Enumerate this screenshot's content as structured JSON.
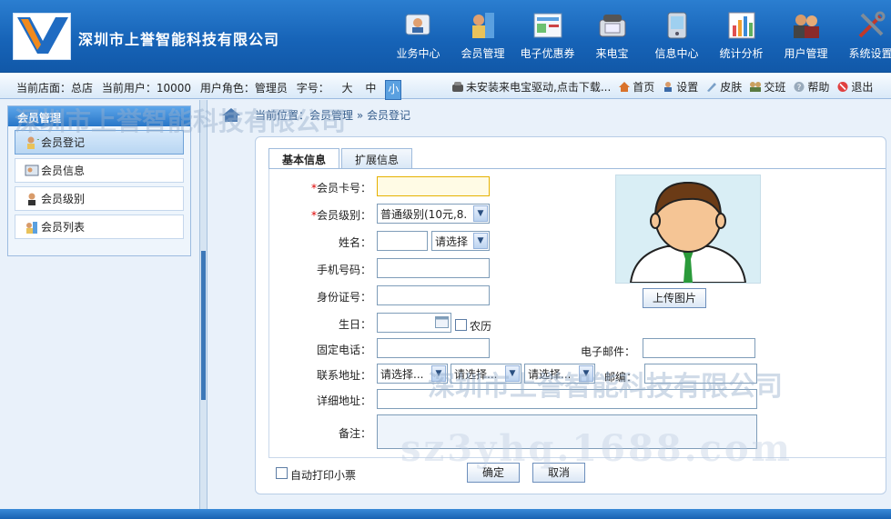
{
  "header": {
    "company": "深圳市上誉智能科技有限公司",
    "nav": [
      {
        "label": "业务中心",
        "icon": "business-center-icon"
      },
      {
        "label": "会员管理",
        "icon": "member-management-icon"
      },
      {
        "label": "电子优惠券",
        "icon": "coupon-icon"
      },
      {
        "label": "来电宝",
        "icon": "phone-icon"
      },
      {
        "label": "信息中心",
        "icon": "info-center-icon"
      },
      {
        "label": "统计分析",
        "icon": "statistics-icon"
      },
      {
        "label": "用户管理",
        "icon": "user-management-icon"
      },
      {
        "label": "系统设置",
        "icon": "settings-icon"
      }
    ]
  },
  "status": {
    "store": "当前店面：总店",
    "user": "当前用户：10000",
    "role": "用户角色：管理员",
    "font_label": "字号：",
    "font_sizes": [
      "大",
      "中",
      "小"
    ],
    "driver_notice": "未安装来电宝驱动,点击下载...",
    "links": [
      "首页",
      "设置",
      "皮肤",
      "交班",
      "帮助",
      "退出"
    ]
  },
  "sidebar": {
    "title": "会员管理",
    "items": [
      "会员登记",
      "会员信息",
      "会员级别",
      "会员列表"
    ]
  },
  "breadcrumb": "当前位置：会员管理 » 会员登记",
  "tabs": [
    "基本信息",
    "扩展信息"
  ],
  "form": {
    "card_no_label": "会员卡号：",
    "level_label": "会员级别：",
    "level_value": "普通级别(10元,8.",
    "name_label": "姓名：",
    "name_select": "请选择",
    "mobile_label": "手机号码：",
    "idcard_label": "身份证号：",
    "birthday_label": "生日：",
    "lunar_label": "农历",
    "phone_label": "固定电话：",
    "email_label": "电子邮件：",
    "address_label": "联系地址：",
    "address_select": "请选择...",
    "zip_label": "邮编：",
    "detail_label": "详细地址：",
    "note_label": "备注：",
    "upload_btn": "上传图片",
    "auto_print": "自动打印小票",
    "confirm_btn": "确定",
    "cancel_btn": "取消"
  },
  "watermark": "深圳市上誉智能科技有限公司",
  "watermark2": "sz3yhq.1688.com",
  "colors": {
    "header": "#1764b8",
    "accent": "#2876c8"
  }
}
